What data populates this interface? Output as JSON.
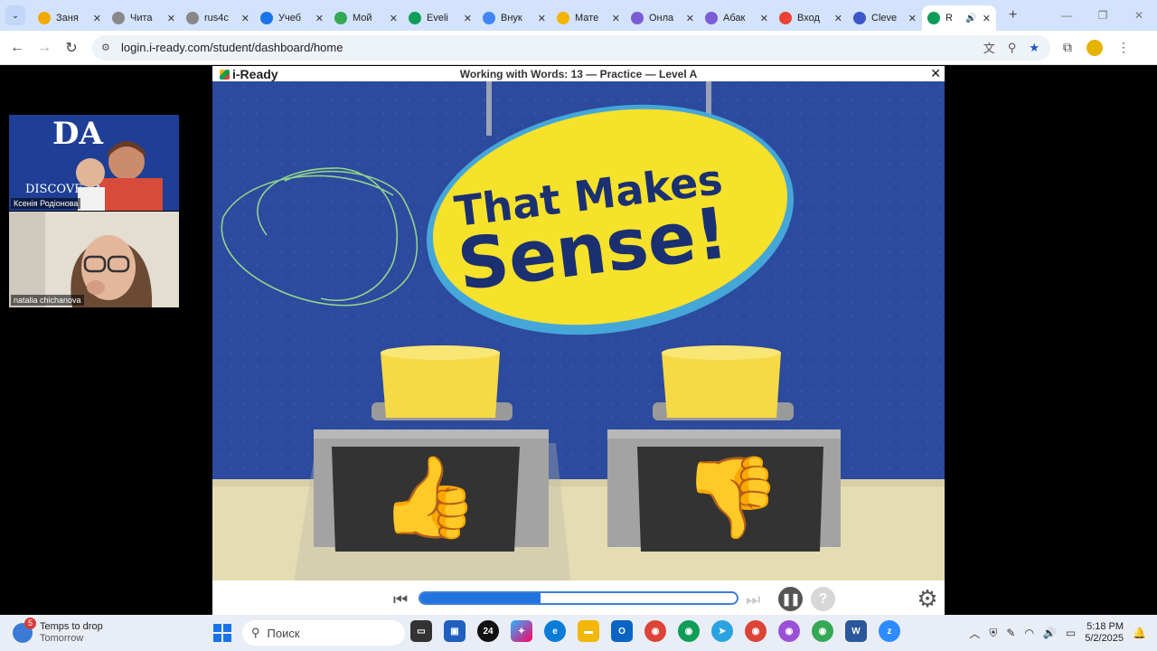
{
  "browser": {
    "tabs": [
      {
        "label": "Заня",
        "color": "#f2a900",
        "icon": "smile-icon"
      },
      {
        "label": "Чита",
        "color": "#888888",
        "icon": "smile-icon"
      },
      {
        "label": "rus4c",
        "color": "#888888",
        "icon": "smile-icon"
      },
      {
        "label": "Учеб",
        "color": "#1a73e8",
        "icon": "o-icon"
      },
      {
        "label": "Мой",
        "color": "#34a853",
        "icon": "drive-icon"
      },
      {
        "label": "Eveli",
        "color": "#0f9d58",
        "icon": "sheets-icon"
      },
      {
        "label": "Внук",
        "color": "#4285f4",
        "icon": "docs-icon"
      },
      {
        "label": "Мате",
        "color": "#f4b400",
        "icon": "slides-icon"
      },
      {
        "label": "Онла",
        "color": "#7b5cd6",
        "icon": "spiral-icon"
      },
      {
        "label": "Абак",
        "color": "#7b5cd6",
        "icon": "spiral-icon"
      },
      {
        "label": "Вход",
        "color": "#ea4335",
        "icon": "gmail-icon"
      },
      {
        "label": "Cleve",
        "color": "#3c57c9",
        "icon": "c-icon"
      },
      {
        "label": "R",
        "color": "#0f9d58",
        "icon": "iready-icon",
        "active": true
      }
    ],
    "url": "login.i-ready.com/student/dashboard/home"
  },
  "video_tiles": [
    {
      "name": "Ксенія Родіонова"
    },
    {
      "name": "natalia chichanova"
    }
  ],
  "player": {
    "logo": "i-Ready",
    "title": "Working with Words: 13 — Practice — Level A",
    "sign_line1": "That Makes",
    "sign_line2": "Sense!",
    "progress": 0.38
  },
  "taskbar": {
    "weather_title": "Temps to drop",
    "weather_sub": "Tomorrow",
    "weather_badge": "5",
    "search_placeholder": "Поиск",
    "time": "5:18 PM",
    "date": "5/2/2025"
  }
}
